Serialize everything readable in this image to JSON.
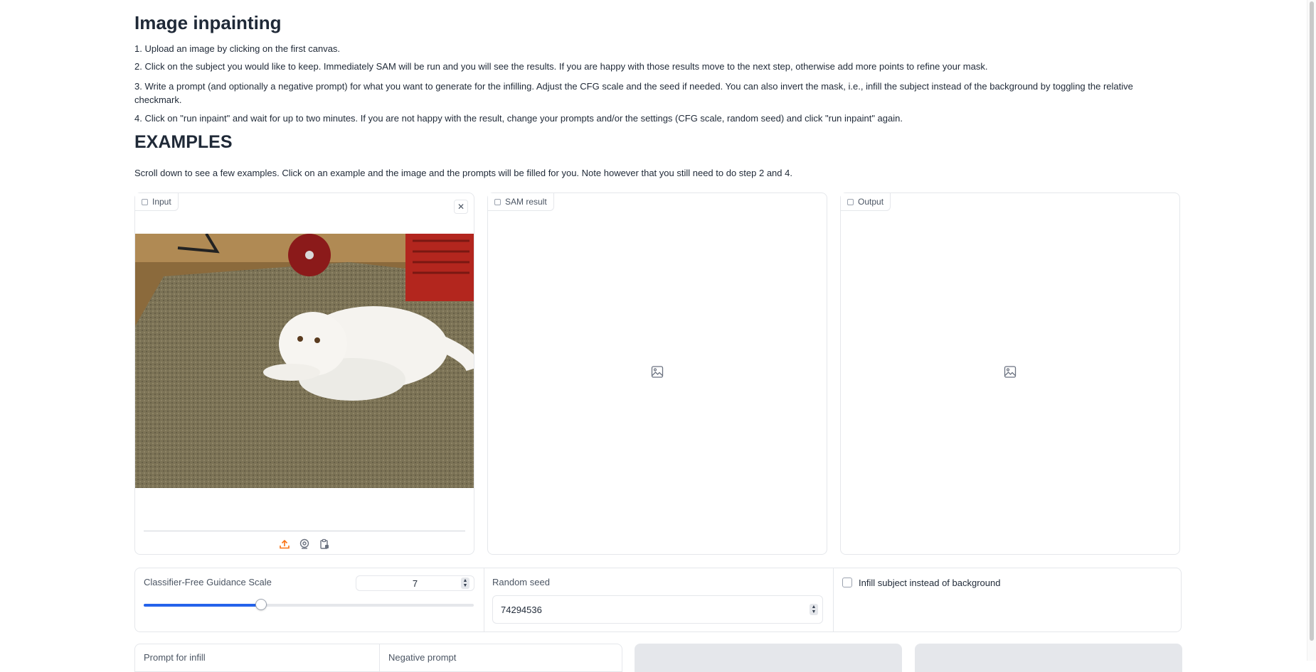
{
  "page": {
    "title": "Image inpainting",
    "steps": [
      "1. Upload an image by clicking on the first canvas.",
      "2. Click on the subject you would like to keep. Immediately SAM will be run and you will see the results. If you are happy with those results move to the next step, otherwise add more points to refine your mask.",
      "3. Write a prompt (and optionally a negative prompt) for what you want to generate for the infilling. Adjust the CFG scale and the seed if needed. You can also invert the mask, i.e., infill the subject instead of the background by toggling the relative checkmark.",
      "4. Click on \"run inpaint\" and wait for up to two minutes. If you are not happy with the result, change your prompts and/or the settings (CFG scale, random seed) and click \"run inpaint\" again."
    ],
    "examples_heading": "EXAMPLES",
    "examples_note": "Scroll down to see a few examples. Click on an example and the image and the prompts will be filled for you. Note however that you still need to do step 2 and 4."
  },
  "panels": {
    "input_label": "Input",
    "sam_label": "SAM result",
    "output_label": "Output"
  },
  "controls": {
    "cfg_label": "Classifier-Free Guidance Scale",
    "cfg_value": "7",
    "cfg_fraction": 0.355,
    "seed_label": "Random seed",
    "seed_value": "74294536",
    "infill_label": "Infill subject instead of background",
    "infill_checked": false
  },
  "prompts": {
    "prompt_label": "Prompt for infill",
    "negative_label": "Negative prompt"
  },
  "icons": {
    "upload": "upload-icon",
    "webcam": "webcam-icon",
    "clipboard": "clipboard-icon",
    "close": "close-icon",
    "image": "image-icon"
  },
  "colors": {
    "accent": "#2563eb",
    "upload_orange": "#f97316"
  }
}
